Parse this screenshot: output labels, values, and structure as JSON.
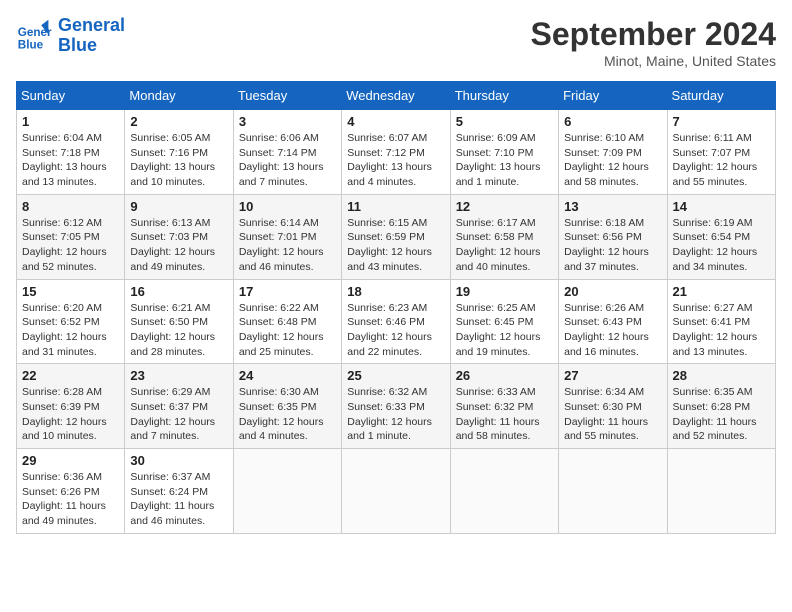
{
  "logo": {
    "line1": "General",
    "line2": "Blue"
  },
  "title": "September 2024",
  "location": "Minot, Maine, United States",
  "days_of_week": [
    "Sunday",
    "Monday",
    "Tuesday",
    "Wednesday",
    "Thursday",
    "Friday",
    "Saturday"
  ],
  "weeks": [
    [
      {
        "day": "1",
        "info": "Sunrise: 6:04 AM\nSunset: 7:18 PM\nDaylight: 13 hours\nand 13 minutes."
      },
      {
        "day": "2",
        "info": "Sunrise: 6:05 AM\nSunset: 7:16 PM\nDaylight: 13 hours\nand 10 minutes."
      },
      {
        "day": "3",
        "info": "Sunrise: 6:06 AM\nSunset: 7:14 PM\nDaylight: 13 hours\nand 7 minutes."
      },
      {
        "day": "4",
        "info": "Sunrise: 6:07 AM\nSunset: 7:12 PM\nDaylight: 13 hours\nand 4 minutes."
      },
      {
        "day": "5",
        "info": "Sunrise: 6:09 AM\nSunset: 7:10 PM\nDaylight: 13 hours\nand 1 minute."
      },
      {
        "day": "6",
        "info": "Sunrise: 6:10 AM\nSunset: 7:09 PM\nDaylight: 12 hours\nand 58 minutes."
      },
      {
        "day": "7",
        "info": "Sunrise: 6:11 AM\nSunset: 7:07 PM\nDaylight: 12 hours\nand 55 minutes."
      }
    ],
    [
      {
        "day": "8",
        "info": "Sunrise: 6:12 AM\nSunset: 7:05 PM\nDaylight: 12 hours\nand 52 minutes."
      },
      {
        "day": "9",
        "info": "Sunrise: 6:13 AM\nSunset: 7:03 PM\nDaylight: 12 hours\nand 49 minutes."
      },
      {
        "day": "10",
        "info": "Sunrise: 6:14 AM\nSunset: 7:01 PM\nDaylight: 12 hours\nand 46 minutes."
      },
      {
        "day": "11",
        "info": "Sunrise: 6:15 AM\nSunset: 6:59 PM\nDaylight: 12 hours\nand 43 minutes."
      },
      {
        "day": "12",
        "info": "Sunrise: 6:17 AM\nSunset: 6:58 PM\nDaylight: 12 hours\nand 40 minutes."
      },
      {
        "day": "13",
        "info": "Sunrise: 6:18 AM\nSunset: 6:56 PM\nDaylight: 12 hours\nand 37 minutes."
      },
      {
        "day": "14",
        "info": "Sunrise: 6:19 AM\nSunset: 6:54 PM\nDaylight: 12 hours\nand 34 minutes."
      }
    ],
    [
      {
        "day": "15",
        "info": "Sunrise: 6:20 AM\nSunset: 6:52 PM\nDaylight: 12 hours\nand 31 minutes."
      },
      {
        "day": "16",
        "info": "Sunrise: 6:21 AM\nSunset: 6:50 PM\nDaylight: 12 hours\nand 28 minutes."
      },
      {
        "day": "17",
        "info": "Sunrise: 6:22 AM\nSunset: 6:48 PM\nDaylight: 12 hours\nand 25 minutes."
      },
      {
        "day": "18",
        "info": "Sunrise: 6:23 AM\nSunset: 6:46 PM\nDaylight: 12 hours\nand 22 minutes."
      },
      {
        "day": "19",
        "info": "Sunrise: 6:25 AM\nSunset: 6:45 PM\nDaylight: 12 hours\nand 19 minutes."
      },
      {
        "day": "20",
        "info": "Sunrise: 6:26 AM\nSunset: 6:43 PM\nDaylight: 12 hours\nand 16 minutes."
      },
      {
        "day": "21",
        "info": "Sunrise: 6:27 AM\nSunset: 6:41 PM\nDaylight: 12 hours\nand 13 minutes."
      }
    ],
    [
      {
        "day": "22",
        "info": "Sunrise: 6:28 AM\nSunset: 6:39 PM\nDaylight: 12 hours\nand 10 minutes."
      },
      {
        "day": "23",
        "info": "Sunrise: 6:29 AM\nSunset: 6:37 PM\nDaylight: 12 hours\nand 7 minutes."
      },
      {
        "day": "24",
        "info": "Sunrise: 6:30 AM\nSunset: 6:35 PM\nDaylight: 12 hours\nand 4 minutes."
      },
      {
        "day": "25",
        "info": "Sunrise: 6:32 AM\nSunset: 6:33 PM\nDaylight: 12 hours\nand 1 minute."
      },
      {
        "day": "26",
        "info": "Sunrise: 6:33 AM\nSunset: 6:32 PM\nDaylight: 11 hours\nand 58 minutes."
      },
      {
        "day": "27",
        "info": "Sunrise: 6:34 AM\nSunset: 6:30 PM\nDaylight: 11 hours\nand 55 minutes."
      },
      {
        "day": "28",
        "info": "Sunrise: 6:35 AM\nSunset: 6:28 PM\nDaylight: 11 hours\nand 52 minutes."
      }
    ],
    [
      {
        "day": "29",
        "info": "Sunrise: 6:36 AM\nSunset: 6:26 PM\nDaylight: 11 hours\nand 49 minutes."
      },
      {
        "day": "30",
        "info": "Sunrise: 6:37 AM\nSunset: 6:24 PM\nDaylight: 11 hours\nand 46 minutes."
      },
      null,
      null,
      null,
      null,
      null
    ]
  ]
}
